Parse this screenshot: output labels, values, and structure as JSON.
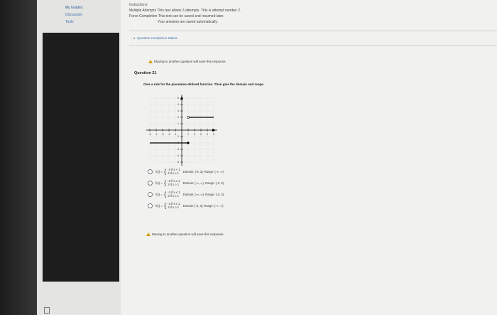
{
  "sidebar": {
    "items": [
      {
        "label": "My Grades"
      },
      {
        "label": "Discussion"
      },
      {
        "label": "Tools"
      }
    ]
  },
  "instructions": {
    "label": "Instructions",
    "attempts": "Multiple Attempts This test allows 3 attempts. This is attempt number 2.",
    "force": "Force Completion This test can be saved and resumed later.",
    "autosave": "Your answers are saved automatically."
  },
  "status": {
    "label": "Question Completion Status:"
  },
  "warnings": {
    "top": "Moving to another question will save this response.",
    "bottom": "Moving to another question will save this response."
  },
  "question": {
    "title": "Question 21",
    "prompt": "Give a rule for the piecewise-defined function. Then give the domain and range."
  },
  "graph": {
    "x_ticks": [
      "-5",
      "-4",
      "-3",
      "-2",
      "-1",
      "1",
      "2",
      "3",
      "4",
      "5"
    ],
    "y_ticks": [
      "5",
      "4",
      "3",
      "2",
      "1",
      "-1",
      "-2",
      "-3",
      "-4",
      "-5"
    ],
    "colors": {
      "line": "#000000",
      "grid": "#cfcfcf"
    }
  },
  "options": [
    {
      "fx": "f(x) =",
      "piece1": "-3  if x < 1",
      "piece2": "3   if x ≥ 1",
      "domain_range": "Domain: (-5, 3], Range: (-∞, ∞)"
    },
    {
      "fx": "f(x) =",
      "piece1": "-3  if x ≤ 1",
      "piece2": "3   if x > 1",
      "domain_range": "Domain: (-∞, ∞), Range: {-3, 3}"
    },
    {
      "fx": "f(x) =",
      "piece1": "-3  if x < 1",
      "piece2": "3   if x ≥ 1",
      "domain_range": "Domain: (-∞, ∞), Range: {-3, 3}"
    },
    {
      "fx": "f(x) =",
      "piece1": "-3  if x ≤ 1",
      "piece2": "3   if x > 1",
      "domain_range": "Domain: [-3, 3], Range: (-∞, ∞)"
    }
  ]
}
